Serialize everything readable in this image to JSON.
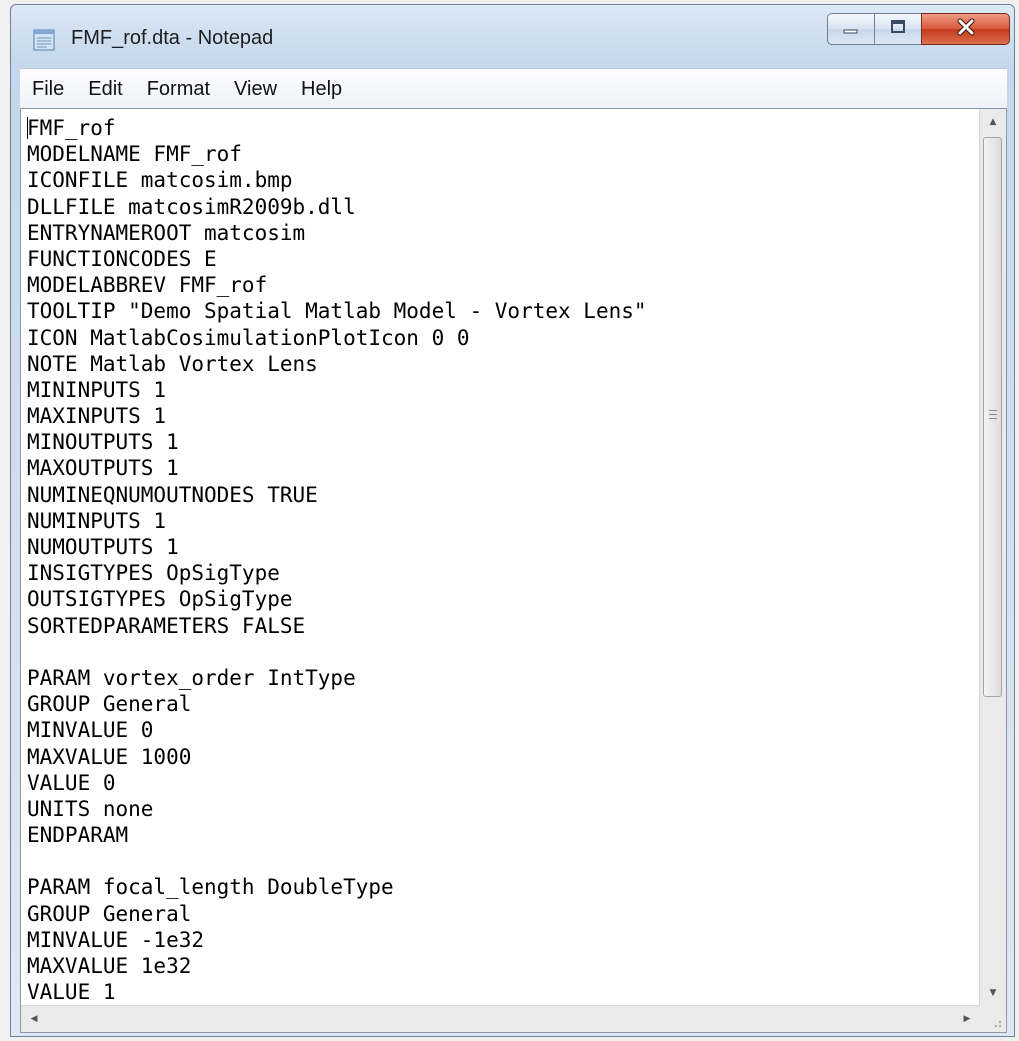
{
  "window": {
    "title": "FMF_rof.dta - Notepad"
  },
  "menu": [
    "File",
    "Edit",
    "Format",
    "View",
    "Help"
  ],
  "editor": {
    "lines": [
      "FMF_rof",
      "MODELNAME FMF_rof",
      "ICONFILE matcosim.bmp",
      "DLLFILE matcosimR2009b.dll",
      "ENTRYNAMEROOT matcosim",
      "FUNCTIONCODES E",
      "MODELABBREV FMF_rof",
      "TOOLTIP \"Demo Spatial Matlab Model - Vortex Lens\"",
      "ICON MatlabCosimulationPlotIcon 0 0",
      "NOTE Matlab Vortex Lens",
      "MININPUTS 1",
      "MAXINPUTS 1",
      "MINOUTPUTS 1",
      "MAXOUTPUTS 1",
      "NUMINEQNUMOUTNODES TRUE",
      "NUMINPUTS 1",
      "NUMOUTPUTS 1",
      "INSIGTYPES OpSigType",
      "OUTSIGTYPES OpSigType",
      "SORTEDPARAMETERS FALSE",
      "",
      "PARAM vortex_order IntType",
      "GROUP General",
      "MINVALUE 0",
      "MAXVALUE 1000",
      "VALUE 0",
      "UNITS none",
      "ENDPARAM",
      "",
      "PARAM focal_length DoubleType",
      "GROUP General",
      "MINVALUE -1e32",
      "MAXVALUE 1e32",
      "VALUE 1"
    ]
  },
  "icons": {
    "app": "notepad-icon",
    "minimize": "minimize-icon",
    "maximize": "maximize-icon",
    "close": "close-icon"
  },
  "colors": {
    "close_button": "#c3391b",
    "title_bar": "#cfdff0"
  }
}
